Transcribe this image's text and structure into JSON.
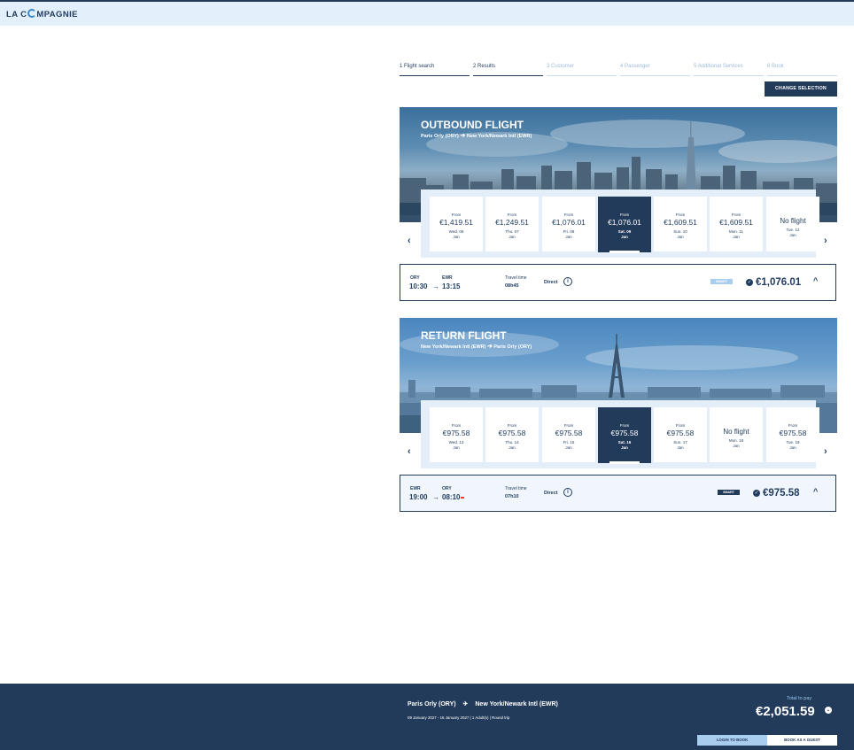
{
  "brand": {
    "logo_text_left": "LA C",
    "logo_text_right": "MPAGNIE"
  },
  "steps": [
    {
      "label": "1  Flight search",
      "state": "done"
    },
    {
      "label": "2  Results",
      "state": "done"
    },
    {
      "label": "3  Customer",
      "state": "todo"
    },
    {
      "label": "4  Passenger",
      "state": "todo"
    },
    {
      "label": "5  Additional Services",
      "state": "todo"
    },
    {
      "label": "6  Book",
      "state": "todo"
    }
  ],
  "change_selection_label": "CHANGE SELECTION",
  "outbound": {
    "title": "OUTBOUND FLIGHT",
    "route_from": "Paris Orly (ORY)",
    "route_to": "New York/Newark Intl (EWR)",
    "dates": [
      {
        "from": "From",
        "price": "€1,419.51",
        "day": "Wed. 06",
        "month": "Jan"
      },
      {
        "from": "From",
        "price": "€1,249.51",
        "day": "Thu. 07",
        "month": "Jan"
      },
      {
        "from": "From",
        "price": "€1,076.01",
        "day": "Fri. 08",
        "month": "Jan"
      },
      {
        "from": "From",
        "price": "€1,076.01",
        "day": "Sat. 09",
        "month": "Jan",
        "selected": true
      },
      {
        "from": "From",
        "price": "€1,609.51",
        "day": "Sun. 10",
        "month": "Jan"
      },
      {
        "from": "From",
        "price": "€1,609.51",
        "day": "Mon. 11",
        "month": "Jan"
      },
      {
        "no_flight": "No flight",
        "day": "Tue. 12",
        "month": "Jan"
      }
    ],
    "flight": {
      "dep_code": "ORY",
      "arr_code": "EWR",
      "dep_time": "10:30",
      "arr_time": "13:15",
      "travel_time_label": "Travel time",
      "travel_time": "08h45",
      "stops": "Direct",
      "fare": "SMART",
      "price": "€1,076.01"
    }
  },
  "return": {
    "title": "RETURN FLIGHT",
    "route_from": "New York/Newark Intl (EWR)",
    "route_to": "Paris Orly (ORY)",
    "dates": [
      {
        "from": "From",
        "price": "€975.58",
        "day": "Wed. 13",
        "month": "Jan"
      },
      {
        "from": "From",
        "price": "€975.58",
        "day": "Thu. 14",
        "month": "Jan"
      },
      {
        "from": "From",
        "price": "€975.58",
        "day": "Fri. 15",
        "month": "Jan"
      },
      {
        "from": "From",
        "price": "€975.58",
        "day": "Sat. 16",
        "month": "Jan",
        "selected": true
      },
      {
        "from": "From",
        "price": "€975.58",
        "day": "Sun. 17",
        "month": "Jan"
      },
      {
        "no_flight": "No flight",
        "day": "Mon. 18",
        "month": "Jan"
      },
      {
        "from": "From",
        "price": "€975.58",
        "day": "Tue. 19",
        "month": "Jan"
      }
    ],
    "flight": {
      "dep_code": "EWR",
      "arr_code": "ORY",
      "dep_time": "19:00",
      "arr_time": "08:10",
      "travel_time_label": "Travel time",
      "travel_time": "07h10",
      "stops": "Direct",
      "fare": "SMART",
      "price": "€975.58"
    }
  },
  "footer": {
    "route_from": "Paris Orly (ORY)",
    "route_to": "New York/Newark Intl (EWR)",
    "meta": "09 January 2027 - 16 January 2027  |  1 Adult(s)  |  Round trip",
    "total_label": "Total to pay",
    "total": "€2,051.59",
    "login_label": "LOGIN TO BOOK",
    "guest_label": "BOOK AS A GUEST"
  },
  "colors": {
    "navy": "#233b5a",
    "light_blue": "#e3effb",
    "accent": "#3d86c6",
    "red": "#e53935"
  }
}
